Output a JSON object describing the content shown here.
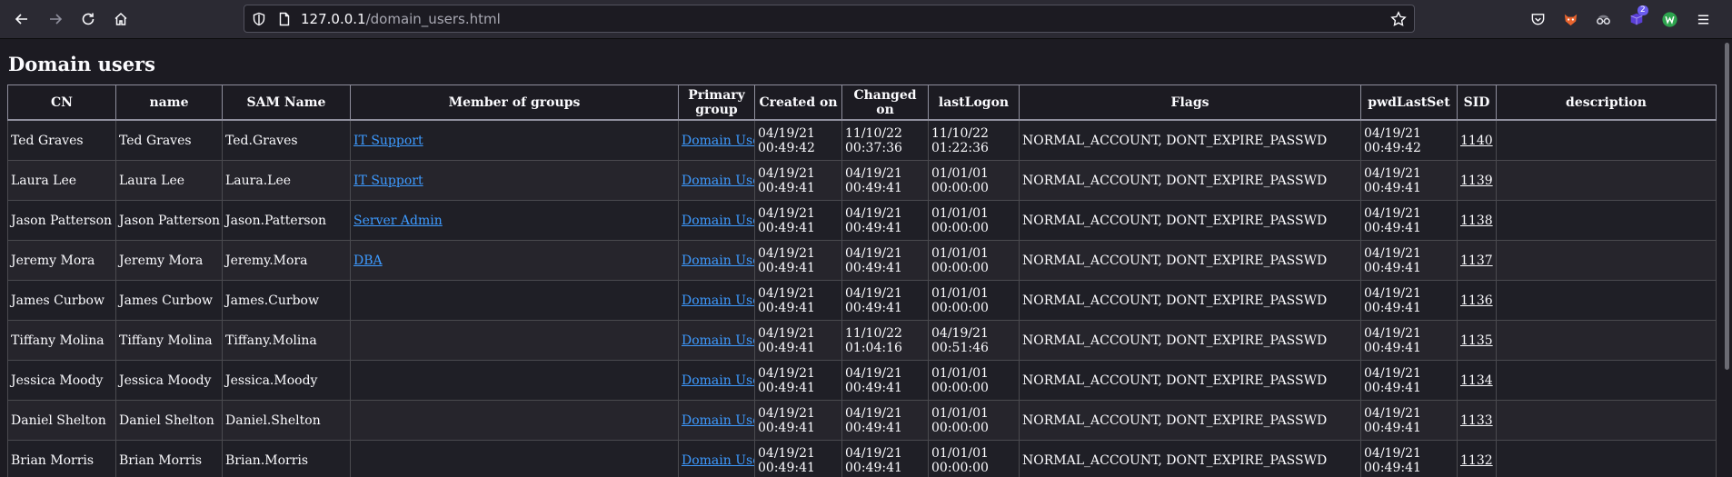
{
  "browser": {
    "url_host": "127.0.0.1",
    "url_path": "/domain_users.html",
    "extension_badge": "2"
  },
  "page": {
    "title": "Domain users",
    "columns": [
      "CN",
      "name",
      "SAM Name",
      "Member of groups",
      "Primary group",
      "Created on",
      "Changed on",
      "lastLogon",
      "Flags",
      "pwdLastSet",
      "SID",
      "description"
    ],
    "rows": [
      {
        "cn": "Ted Graves",
        "name": "Ted Graves",
        "sam": "Ted.Graves",
        "groups": "IT Support",
        "primary_group": "Domain Users",
        "created_date": "04/19/21",
        "created_time": "00:49:42",
        "changed_date": "11/10/22",
        "changed_time": "00:37:36",
        "lastlogon_date": "11/10/22",
        "lastlogon_time": "01:22:36",
        "flags": "NORMAL_ACCOUNT, DONT_EXPIRE_PASSWD",
        "pwd_date": "04/19/21",
        "pwd_time": "00:49:42",
        "sid": "1140",
        "description": ""
      },
      {
        "cn": "Laura Lee",
        "name": "Laura Lee",
        "sam": "Laura.Lee",
        "groups": "IT Support",
        "primary_group": "Domain Users",
        "created_date": "04/19/21",
        "created_time": "00:49:41",
        "changed_date": "04/19/21",
        "changed_time": "00:49:41",
        "lastlogon_date": "01/01/01",
        "lastlogon_time": "00:00:00",
        "flags": "NORMAL_ACCOUNT, DONT_EXPIRE_PASSWD",
        "pwd_date": "04/19/21",
        "pwd_time": "00:49:41",
        "sid": "1139",
        "description": ""
      },
      {
        "cn": "Jason Patterson",
        "name": "Jason Patterson",
        "sam": "Jason.Patterson",
        "groups": "Server Admin",
        "primary_group": "Domain Users",
        "created_date": "04/19/21",
        "created_time": "00:49:41",
        "changed_date": "04/19/21",
        "changed_time": "00:49:41",
        "lastlogon_date": "01/01/01",
        "lastlogon_time": "00:00:00",
        "flags": "NORMAL_ACCOUNT, DONT_EXPIRE_PASSWD",
        "pwd_date": "04/19/21",
        "pwd_time": "00:49:41",
        "sid": "1138",
        "description": ""
      },
      {
        "cn": "Jeremy Mora",
        "name": "Jeremy Mora",
        "sam": "Jeremy.Mora",
        "groups": "DBA",
        "primary_group": "Domain Users",
        "created_date": "04/19/21",
        "created_time": "00:49:41",
        "changed_date": "04/19/21",
        "changed_time": "00:49:41",
        "lastlogon_date": "01/01/01",
        "lastlogon_time": "00:00:00",
        "flags": "NORMAL_ACCOUNT, DONT_EXPIRE_PASSWD",
        "pwd_date": "04/19/21",
        "pwd_time": "00:49:41",
        "sid": "1137",
        "description": ""
      },
      {
        "cn": "James Curbow",
        "name": "James Curbow",
        "sam": "James.Curbow",
        "groups": "",
        "primary_group": "Domain Users",
        "created_date": "04/19/21",
        "created_time": "00:49:41",
        "changed_date": "04/19/21",
        "changed_time": "00:49:41",
        "lastlogon_date": "01/01/01",
        "lastlogon_time": "00:00:00",
        "flags": "NORMAL_ACCOUNT, DONT_EXPIRE_PASSWD",
        "pwd_date": "04/19/21",
        "pwd_time": "00:49:41",
        "sid": "1136",
        "description": ""
      },
      {
        "cn": "Tiffany Molina",
        "name": "Tiffany Molina",
        "sam": "Tiffany.Molina",
        "groups": "",
        "primary_group": "Domain Users",
        "created_date": "04/19/21",
        "created_time": "00:49:41",
        "changed_date": "11/10/22",
        "changed_time": "01:04:16",
        "lastlogon_date": "04/19/21",
        "lastlogon_time": "00:51:46",
        "flags": "NORMAL_ACCOUNT, DONT_EXPIRE_PASSWD",
        "pwd_date": "04/19/21",
        "pwd_time": "00:49:41",
        "sid": "1135",
        "description": ""
      },
      {
        "cn": "Jessica Moody",
        "name": "Jessica Moody",
        "sam": "Jessica.Moody",
        "groups": "",
        "primary_group": "Domain Users",
        "created_date": "04/19/21",
        "created_time": "00:49:41",
        "changed_date": "04/19/21",
        "changed_time": "00:49:41",
        "lastlogon_date": "01/01/01",
        "lastlogon_time": "00:00:00",
        "flags": "NORMAL_ACCOUNT, DONT_EXPIRE_PASSWD",
        "pwd_date": "04/19/21",
        "pwd_time": "00:49:41",
        "sid": "1134",
        "description": ""
      },
      {
        "cn": "Daniel Shelton",
        "name": "Daniel Shelton",
        "sam": "Daniel.Shelton",
        "groups": "",
        "primary_group": "Domain Users",
        "created_date": "04/19/21",
        "created_time": "00:49:41",
        "changed_date": "04/19/21",
        "changed_time": "00:49:41",
        "lastlogon_date": "01/01/01",
        "lastlogon_time": "00:00:00",
        "flags": "NORMAL_ACCOUNT, DONT_EXPIRE_PASSWD",
        "pwd_date": "04/19/21",
        "pwd_time": "00:49:41",
        "sid": "1133",
        "description": ""
      },
      {
        "cn": "Brian Morris",
        "name": "Brian Morris",
        "sam": "Brian.Morris",
        "groups": "",
        "primary_group": "Domain Users",
        "created_date": "04/19/21",
        "created_time": "00:49:41",
        "changed_date": "04/19/21",
        "changed_time": "00:49:41",
        "lastlogon_date": "01/01/01",
        "lastlogon_time": "00:00:00",
        "flags": "NORMAL_ACCOUNT, DONT_EXPIRE_PASSWD",
        "pwd_date": "04/19/21",
        "pwd_time": "00:49:41",
        "sid": "1132",
        "description": ""
      }
    ]
  }
}
